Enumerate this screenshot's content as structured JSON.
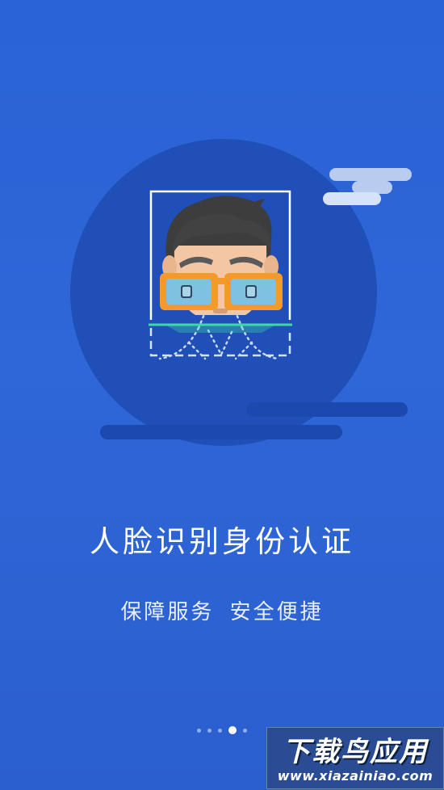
{
  "onboarding": {
    "title": "人脸识别身份认证",
    "subtitle_parts": [
      "保障服务",
      "安全便捷"
    ],
    "page_count": 5,
    "active_page": 4
  },
  "watermark": {
    "title": "下载鸟应用",
    "url": "www.xiazainiao.com"
  },
  "icons": {
    "illustration": "face-recognition-illustration"
  },
  "colors": {
    "background": "#2f66d8",
    "circle": "#1f4fb7",
    "glasses": "#f39a2a",
    "scan_line": "#3fd8a8"
  }
}
